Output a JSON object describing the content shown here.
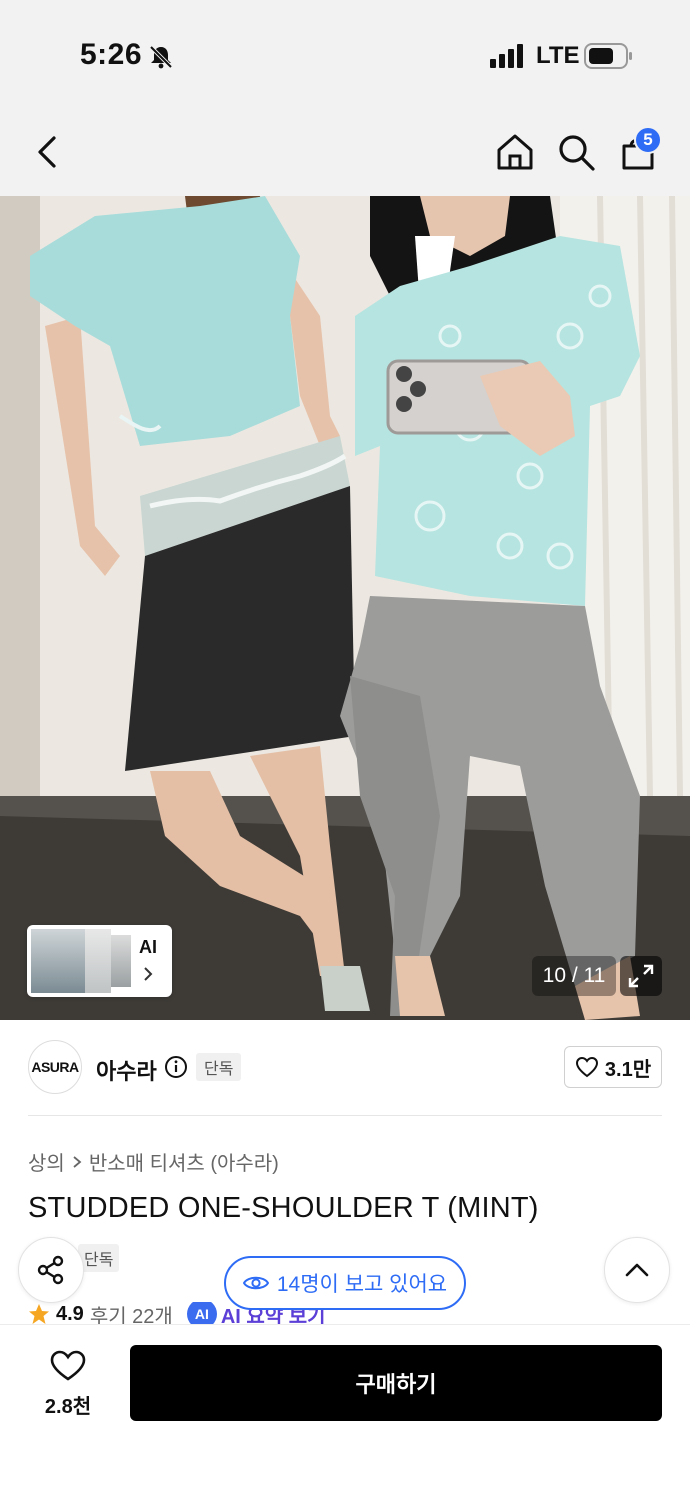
{
  "status_bar": {
    "time": "5:26",
    "network": "LTE"
  },
  "nav": {
    "cart_count": "5"
  },
  "gallery": {
    "ai_label": "AI",
    "counter": "10 / 11",
    "current_index": 10,
    "total": 11
  },
  "brand": {
    "logo_text": "ASURA",
    "name": "아수라",
    "exclusive_badge": "단독",
    "like_count": "3.1만"
  },
  "breadcrumb": {
    "category": "상의",
    "subcategory": "반소매 티셔츠 (아수라)"
  },
  "product": {
    "title": "STUDDED ONE-SHOULDER T (MINT)",
    "exclusive_badge": "단독",
    "viewers_text": "14명이 보고 있어요",
    "rating": "4.9",
    "reviews": "후기 22개",
    "ai_summary_label": "AI 요약 보기",
    "ai_chip_text": "AI"
  },
  "bottom_bar": {
    "wish_count": "2.8천",
    "buy_label": "구매하기"
  },
  "colors": {
    "accent_blue": "#2e6cf6",
    "buy_button_bg": "#000000",
    "mint_top": "#a9dede",
    "ai_purple": "#5b3fd6"
  }
}
